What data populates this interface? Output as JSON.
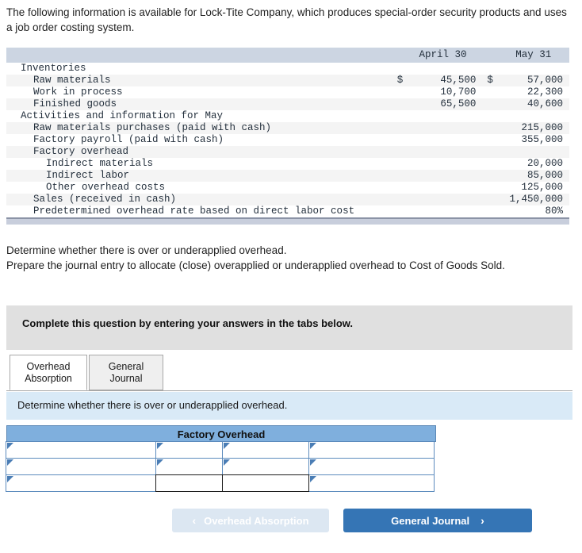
{
  "intro": "The following information is available for Lock-Tite Company, which produces special-order security products and uses a job order costing system.",
  "fact_table": {
    "columns": [
      "",
      "April 30",
      "May 31"
    ],
    "rows": [
      {
        "label": "Inventories",
        "indent": 0,
        "cur1": "",
        "val1": "",
        "cur2": "",
        "val2": ""
      },
      {
        "label": "Raw materials",
        "indent": 1,
        "cur1": "$",
        "val1": "45,500",
        "cur2": "$",
        "val2": "57,000"
      },
      {
        "label": "Work in process",
        "indent": 1,
        "cur1": "",
        "val1": "10,700",
        "cur2": "",
        "val2": "22,300"
      },
      {
        "label": "Finished goods",
        "indent": 1,
        "cur1": "",
        "val1": "65,500",
        "cur2": "",
        "val2": "40,600"
      },
      {
        "label": "Activities and information for May",
        "indent": 0,
        "cur1": "",
        "val1": "",
        "cur2": "",
        "val2": ""
      },
      {
        "label": "Raw materials purchases (paid with cash)",
        "indent": 1,
        "cur1": "",
        "val1": "",
        "cur2": "",
        "val2": "215,000"
      },
      {
        "label": "Factory payroll (paid with cash)",
        "indent": 1,
        "cur1": "",
        "val1": "",
        "cur2": "",
        "val2": "355,000"
      },
      {
        "label": "Factory overhead",
        "indent": 1,
        "cur1": "",
        "val1": "",
        "cur2": "",
        "val2": ""
      },
      {
        "label": "Indirect materials",
        "indent": 2,
        "cur1": "",
        "val1": "",
        "cur2": "",
        "val2": "20,000"
      },
      {
        "label": "Indirect labor",
        "indent": 2,
        "cur1": "",
        "val1": "",
        "cur2": "",
        "val2": "85,000"
      },
      {
        "label": "Other overhead costs",
        "indent": 2,
        "cur1": "",
        "val1": "",
        "cur2": "",
        "val2": "125,000"
      },
      {
        "label": "Sales (received in cash)",
        "indent": 1,
        "cur1": "",
        "val1": "",
        "cur2": "",
        "val2": "1,450,000"
      },
      {
        "label": "Predetermined overhead rate based on direct labor cost",
        "indent": 1,
        "cur1": "",
        "val1": "",
        "cur2": "",
        "val2": "80%"
      }
    ]
  },
  "requirements": [
    "Determine whether there is over or underapplied overhead.",
    "Prepare the journal entry to allocate (close) overapplied or underapplied overhead to Cost of Goods Sold."
  ],
  "banner": {
    "text": "Complete this question by entering your answers in the tabs below."
  },
  "tabs": [
    {
      "line1": "Overhead",
      "line2": "Absorption",
      "active": true
    },
    {
      "line1": "General",
      "line2": "Journal",
      "active": false
    }
  ],
  "instruction_bar": {
    "text": "Determine whether there is over or underapplied overhead."
  },
  "factory_overhead_grid": {
    "title": "Factory Overhead",
    "rows": [
      [
        {
          "value": "",
          "marker": true,
          "total": false
        },
        {
          "value": "",
          "marker": true,
          "total": false
        },
        {
          "value": "",
          "marker": true,
          "total": false
        },
        {
          "value": "",
          "marker": true,
          "total": false
        }
      ],
      [
        {
          "value": "",
          "marker": true,
          "total": false
        },
        {
          "value": "",
          "marker": true,
          "total": false
        },
        {
          "value": "",
          "marker": true,
          "total": false
        },
        {
          "value": "",
          "marker": true,
          "total": false
        }
      ],
      [
        {
          "value": "",
          "marker": true,
          "total": false
        },
        {
          "value": "",
          "marker": false,
          "total": true
        },
        {
          "value": "",
          "marker": false,
          "total": true
        },
        {
          "value": "",
          "marker": true,
          "total": false
        }
      ]
    ]
  },
  "navigation": {
    "prev_label": "Overhead Absorption",
    "prev_chevron": "‹",
    "prev_disabled": true,
    "next_label": "General Journal",
    "next_chevron": "›"
  },
  "colors": {
    "accent_blue": "#3575b5",
    "grid_header_blue": "#7fafdd",
    "instruction_blue": "#d9eaf7",
    "banner_gray": "#e0e0e0",
    "table_header": "#ccd5e2"
  }
}
